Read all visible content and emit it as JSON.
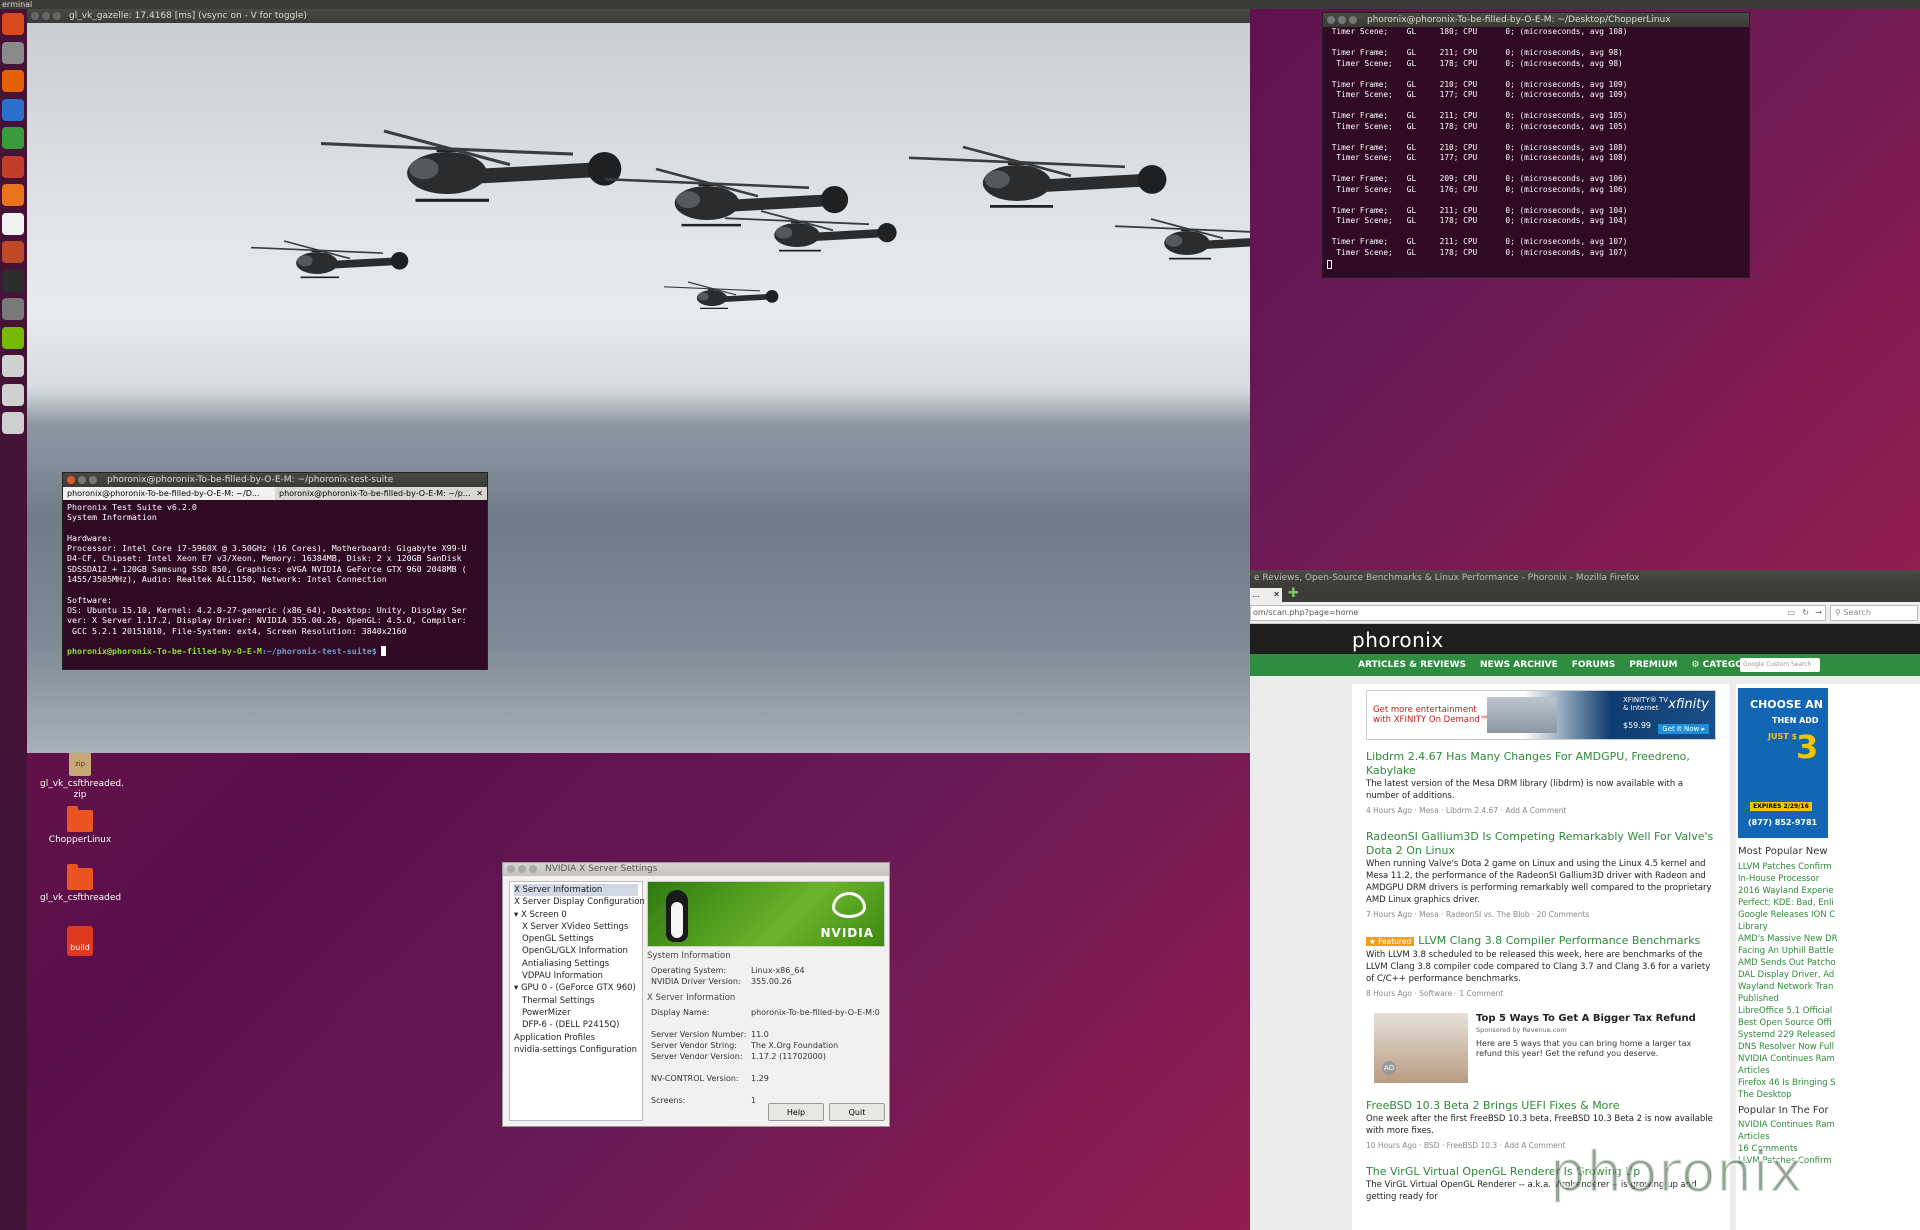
{
  "topbar": {
    "label": "erminal"
  },
  "launcher": {
    "icons": [
      "dash-icon",
      "files-icon",
      "firefox-icon",
      "writer-icon",
      "calc-icon",
      "impress-icon",
      "software-center-icon",
      "amazon-icon",
      "settings-icon",
      "terminal-icon",
      "help-icon",
      "nvidia-icon",
      "drive-icon",
      "drive-icon-2",
      "usb-icon"
    ]
  },
  "gfx": {
    "title": "gl_vk_gazelle: 17.4168 [ms] (vsync on - V for toggle)"
  },
  "term_pts": {
    "title": "phoronix@phoronix-To-be-filled-by-O-E-M: ~/phoronix-test-suite",
    "tabs": [
      "phoronix@phoronix-To-be-filled-by-O-E-M: ~/D...",
      "phoronix@phoronix-To-be-filled-by-O-E-M: ~/p..."
    ],
    "lines": [
      "Phoronix Test Suite v6.2.0",
      "System Information",
      "",
      "Hardware:",
      "Processor: Intel Core i7-5960X @ 3.50GHz (16 Cores), Motherboard: Gigabyte X99-U",
      "D4-CF, Chipset: Intel Xeon E7 v3/Xeon, Memory: 16384MB, Disk: 2 x 120GB SanDisk",
      "SDSSDA12 + 120GB Samsung SSD 850, Graphics: eVGA NVIDIA GeForce GTX 960 2048MB (",
      "1455/3505MHz), Audio: Realtek ALC1150, Network: Intel Connection",
      "",
      "Software:",
      "OS: Ubuntu 15.10, Kernel: 4.2.0-27-generic (x86_64), Desktop: Unity, Display Ser",
      "ver: X Server 1.17.2, Display Driver: NVIDIA 355.00.26, OpenGL: 4.5.0, Compiler:",
      " GCC 5.2.1 20151010, File-System: ext4, Screen Resolution: 3840x2160"
    ],
    "prompt_user": "phoronix@phoronix-To-be-filled-by-O-E-M",
    "prompt_path": ":~/phoronix-test-suite$"
  },
  "term_chop": {
    "title": "phoronix@phoronix-To-be-filled-by-O-E-M: ~/Desktop/ChopperLinux",
    "lines": [
      " Timer Scene;    GL     180; CPU      0; (microseconds, avg 108)",
      "",
      " Timer Frame;    GL     211; CPU      0; (microseconds, avg 98)",
      "  Timer Scene;   GL     178; CPU      0; (microseconds, avg 98)",
      "",
      " Timer Frame;    GL     210; CPU      0; (microseconds, avg 109)",
      "  Timer Scene;   GL     177; CPU      0; (microseconds, avg 109)",
      "",
      " Timer Frame;    GL     211; CPU      0; (microseconds, avg 105)",
      "  Timer Scene;   GL     178; CPU      0; (microseconds, avg 105)",
      "",
      " Timer Frame;    GL     210; CPU      0; (microseconds, avg 108)",
      "  Timer Scene;   GL     177; CPU      0; (microseconds, avg 108)",
      "",
      " Timer Frame;    GL     209; CPU      0; (microseconds, avg 106)",
      "  Timer Scene;   GL     176; CPU      0; (microseconds, avg 106)",
      "",
      " Timer Frame;    GL     211; CPU      0; (microseconds, avg 104)",
      "  Timer Scene;   GL     178; CPU      0; (microseconds, avg 104)",
      "",
      " Timer Frame;    GL     211; CPU      0; (microseconds, avg 107)",
      "  Timer Scene;   GL     178; CPU      0; (microseconds, avg 107)"
    ]
  },
  "desktop": {
    "icons": [
      {
        "label": "gl_vk_csfthreaded.\nzip",
        "badge": "zip"
      },
      {
        "label": "ChopperLinux"
      },
      {
        "label": "gl_vk_csfthreaded"
      },
      {
        "label": "build"
      }
    ]
  },
  "nvidia": {
    "title": "NVIDIA X Server Settings",
    "tree": [
      "X Server Information",
      "X Server Display Configuration",
      "▾ X Screen 0",
      "X Server XVideo Settings",
      "OpenGL Settings",
      "OpenGL/GLX Information",
      "Antialiasing Settings",
      "VDPAU Information",
      "▾ GPU 0 - (GeForce GTX 960)",
      "Thermal Settings",
      "PowerMizer",
      "DFP-6 - (DELL P2415Q)",
      "Application Profiles",
      "nvidia-settings Configuration"
    ],
    "logo": "NVIDIA",
    "sys_header": "System Information",
    "sys": [
      [
        "Operating System:",
        "Linux-x86_64"
      ],
      [
        "NVIDIA Driver Version:",
        "355.00.26"
      ]
    ],
    "xs_header": "X Server Information",
    "xs": [
      [
        "Display Name:",
        "phoronix-To-be-filled-by-O-E-M:0"
      ],
      [
        "",
        ""
      ],
      [
        "Server Version Number:",
        "11.0"
      ],
      [
        "Server Vendor String:",
        "The X.Org Foundation"
      ],
      [
        "Server Vendor Version:",
        "1.17.2 (11702000)"
      ],
      [
        "",
        ""
      ],
      [
        "NV-CONTROL Version:",
        "1.29"
      ],
      [
        "",
        ""
      ],
      [
        "Screens:",
        "1"
      ]
    ],
    "help": "Help",
    "quit": "Quit"
  },
  "firefox": {
    "title": "e Reviews, Open-Source Benchmarks & Linux Performance - Phoronix - Mozilla Firefox",
    "url": "om/scan.php?page=home",
    "search_placeholder": "Search",
    "logo": "phoronix",
    "nav": [
      "ARTICLES & REVIEWS",
      "NEWS ARCHIVE",
      "FORUMS",
      "PREMIUM",
      "⚙ CATEGORIES"
    ],
    "google_ph": "Google Custom Search",
    "ad": {
      "line1": "Get more entertainment",
      "line2": "with XFINITY On Demand™",
      "brand": "xfinity",
      "offer": "XFINITY® TV & Internet",
      "price": "$59.99",
      "cta": "Get It Now ▸"
    },
    "articles": [
      {
        "title": "Libdrm 2.4.67 Has Many Changes For AMDGPU, Freedreno, Kabylake",
        "desc": "The latest version of the Mesa DRM library (libdrm) is now available with a number of additions.",
        "meta": "4 Hours Ago · Mesa · Libdrm 2.4.67 · Add A Comment"
      },
      {
        "title": "RadeonSI Gallium3D Is Competing Remarkably Well For Valve's Dota 2 On Linux",
        "desc": "When running Valve's Dota 2 game on Linux and using the Linux 4.5 kernel and Mesa 11.2, the performance of the RadeonSI Gallium3D driver with Radeon and AMDGPU DRM drivers is performing remarkably well compared to the proprietary AMD Linux graphics driver.",
        "meta": "7 Hours Ago · Mesa · RadeonSI vs. The Blob · 20 Comments"
      },
      {
        "badge": "Featured",
        "title": "LLVM Clang 3.8 Compiler Performance Benchmarks",
        "desc": "With LLVM 3.8 scheduled to be released this week, here are benchmarks of the LLVM Clang 3.8 compiler code compared to Clang 3.7 and Clang 3.6 for a variety of C/C++ performance benchmarks.",
        "meta": "8 Hours Ago · Software · 1 Comment"
      },
      {
        "title": "FreeBSD 10.3 Beta 2 Brings UEFI Fixes & More",
        "desc": "One week after the first FreeBSD 10.3 beta, FreeBSD 10.3 Beta 2 is now available with more fixes.",
        "meta": "10 Hours Ago · BSD · FreeBSD 10.3 · Add A Comment"
      },
      {
        "title": "The VirGL Virtual OpenGL Renderer Is Growing Up",
        "desc": "The VirGL Virtual OpenGL Renderer -- a.k.a. Virglrenderer -- is growing up and getting ready for"
      }
    ],
    "sponsored": {
      "title": "Top 5 Ways To Get A Bigger Tax Refund",
      "by": "Sponsored by Revenue.com",
      "desc": "Here are 5 ways that you can bring home a larger tax refund this year! Get the refund you deserve.",
      "adlabel": "AD"
    },
    "side_ad": {
      "l1": "CHOOSE AN",
      "l2": "THEN ADD",
      "l3": "JUST $",
      "l4": "3",
      "exp": "EXPIRES 2/29/16",
      "phone": "(877) 852-9781"
    },
    "popular_header": "Most Popular New",
    "popular": [
      "LLVM Patches Confirm",
      "In-House Processor",
      "2016 Wayland Experie",
      "Perfect; KDE: Bad, Enli",
      "Google Releases ION C",
      "Library",
      "AMD's Massive New DR",
      "Facing An Uphill Battle",
      "AMD Sends Out Patcho",
      "DAL Display Driver, Ad",
      "Wayland Network Tran",
      "Published",
      "LibreOffice 5.1 Official",
      "Best Open Source Offi",
      "Systemd 229 Released",
      "DNS Resolver Now Full",
      "NVIDIA Continues Ram",
      "Articles",
      "Firefox 46 Is Bringing S",
      "The Desktop"
    ],
    "popular2_header": "Popular In The For",
    "popular2": [
      "NVIDIA Continues Ram",
      "Articles",
      "16 Comments",
      "LLVM Patches Confirm"
    ],
    "watermark": "phoronix"
  }
}
